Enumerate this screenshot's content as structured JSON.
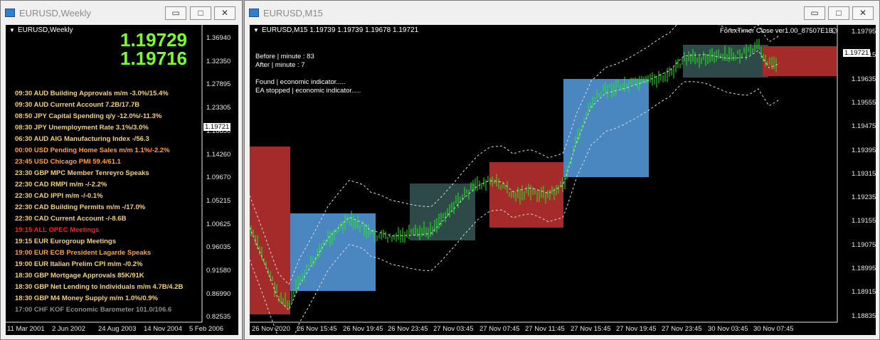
{
  "left_window": {
    "title": "EURUSD,Weekly",
    "chart_label": "EURUSD,Weekly",
    "price_big_1": "1.19729",
    "price_big_2": "1.19716",
    "current_price": "1.19721",
    "y_ticks": [
      "1.36940",
      "1.32350",
      "1.27895",
      "1.23305",
      "1.18850",
      "1.14260",
      "1.09670",
      "1.05215",
      "1.00625",
      "0.96035",
      "0.91580",
      "0.86990",
      "0.82535"
    ],
    "x_ticks": [
      "11 Mar 2001",
      "2 Jun 2002",
      "24 Aug 2003",
      "14 Nov 2004",
      "5 Feb 2006"
    ],
    "news": [
      {
        "text": "09:30 AUD Building Approvals m/m   -3.0%/15.4%",
        "color": "#f5d27a"
      },
      {
        "text": "09:30 AUD Current Account   7.2B/17.7B",
        "color": "#f5d27a"
      },
      {
        "text": "08:50 JPY Capital Spending q/y   -12.0%/-11.3%",
        "color": "#f5d27a"
      },
      {
        "text": "08:30 JPY Unemployment Rate   3.1%/3.0%",
        "color": "#f5d27a"
      },
      {
        "text": "06:30 AUD AIG Manufacturing Index   -/56.3",
        "color": "#f5d27a"
      },
      {
        "text": "00:00 USD Pending Home Sales m/m   1.1%/-2.2%",
        "color": "#ffa040"
      },
      {
        "text": "23:45 USD Chicago PMI   59.4/61.1",
        "color": "#ffa040"
      },
      {
        "text": "23:30 GBP MPC Member Tenreyro Speaks",
        "color": "#f5d27a"
      },
      {
        "text": "22:30 CAD RMPI m/m   -/-2.2%",
        "color": "#f5d27a"
      },
      {
        "text": "22:30 CAD IPPI m/m   -/-0.1%",
        "color": "#f5d27a"
      },
      {
        "text": "22:30 CAD Building Permits m/m   -/17.0%",
        "color": "#f5d27a"
      },
      {
        "text": "22:30 CAD Current Account   -/-8.6B",
        "color": "#f5d27a"
      },
      {
        "text": "19:15 ALL OPEC Meetings",
        "color": "#ff2020"
      },
      {
        "text": "19:15 EUR Eurogroup Meetings",
        "color": "#f5d27a"
      },
      {
        "text": "19:00 EUR ECB President Lagarde Speaks",
        "color": "#ffa040"
      },
      {
        "text": "19:00 EUR Italian Prelim CPI m/m   -/0.2%",
        "color": "#f5d27a"
      },
      {
        "text": "18:30 GBP Mortgage Approvals   85K/91K",
        "color": "#f5d27a"
      },
      {
        "text": "18:30 GBP Net Lending to Individuals m/m   4.7B/4.2B",
        "color": "#f5d27a"
      },
      {
        "text": "18:30 GBP M4 Money Supply m/m   1.0%/0.9%",
        "color": "#f5d27a"
      },
      {
        "text": "17:00 CHF KOF Economic Barometer   101.0/106.6",
        "color": "#8c8c8c"
      }
    ]
  },
  "right_window": {
    "title": "EURUSD,M15",
    "ohlc_label": "EURUSD,M15  1.19739 1.19739 1.19678 1.19721",
    "indicator_label": "ForexTimer Close ver1.00_87507E1B",
    "smiley": "☺",
    "info_lines": [
      "Before | minute : 83",
      "After    | minute : 7",
      "",
      "Found | economic indicator.....",
      "EA stopped | economic indicator....."
    ],
    "current_price": "1.19721",
    "y_ticks": [
      "1.19795",
      "1.19715",
      "1.19635",
      "1.19555",
      "1.19475",
      "1.19395",
      "1.19315",
      "1.19235",
      "1.19155",
      "1.19075",
      "1.18995",
      "1.18915",
      "1.18835"
    ],
    "x_ticks": [
      "26 Nov 2020",
      "26 Nov 15:45",
      "26 Nov 19:45",
      "26 Nov 23:45",
      "27 Nov 03:45",
      "27 Nov 07:45",
      "27 Nov 11:45",
      "27 Nov 15:45",
      "27 Nov 19:45",
      "27 Nov 23:45",
      "30 Nov 03:45",
      "30 Nov 07:45"
    ],
    "colors": {
      "bull_box": "#4a86c0",
      "bear_box": "#a52a2a",
      "neutral_box": "#2e4a48",
      "bars": "#22ee22",
      "band": "#dddddd"
    }
  },
  "window_buttons": {
    "minimize": "▭",
    "maximize": "□",
    "close": "✕"
  }
}
